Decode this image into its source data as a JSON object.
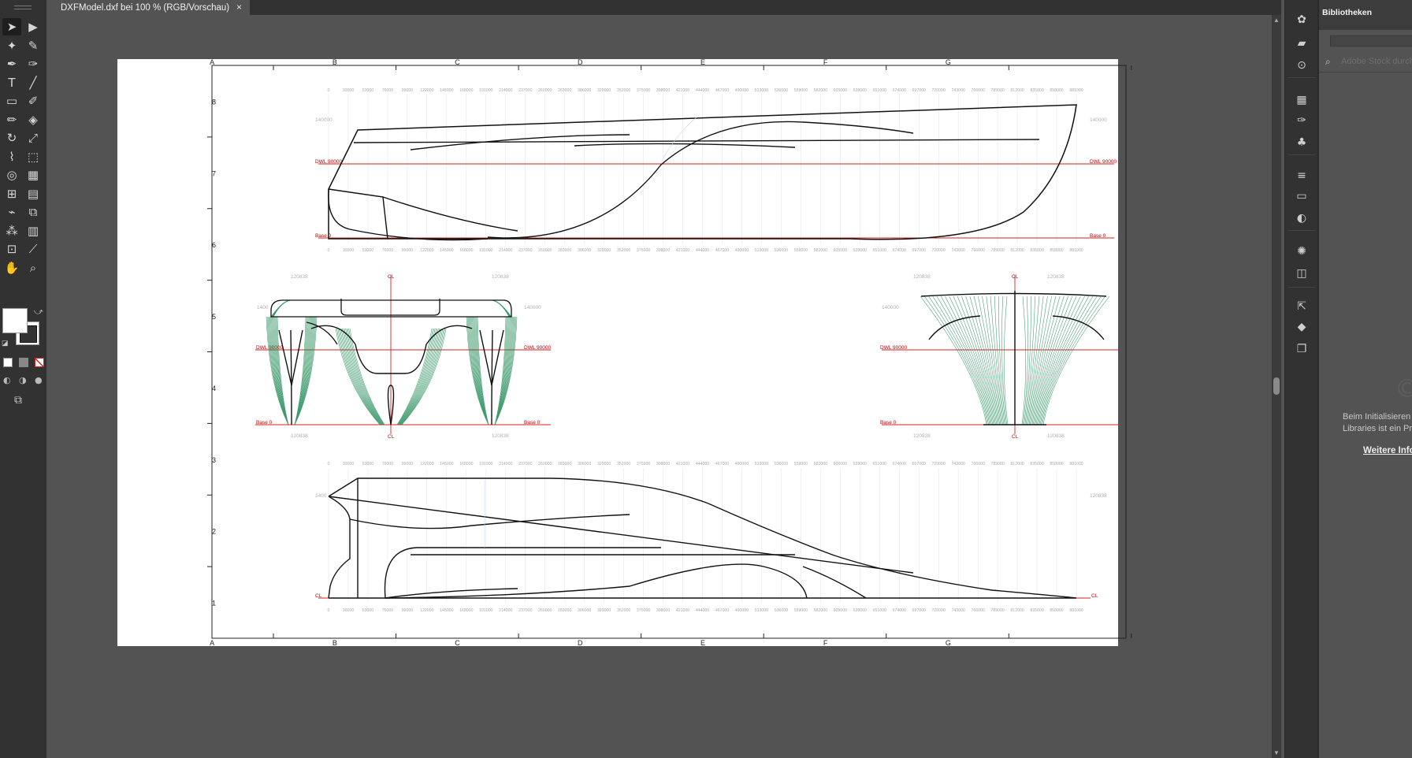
{
  "document_tab": {
    "title": "DXFModel.dxf bei 100 % (RGB/Vorschau)",
    "close": "×"
  },
  "tools": [
    {
      "name": "selection-tool",
      "glyph": "➤"
    },
    {
      "name": "direct-selection-tool",
      "glyph": "▶"
    },
    {
      "name": "magic-wand-tool",
      "glyph": "✦"
    },
    {
      "name": "lasso-tool",
      "glyph": "✎"
    },
    {
      "name": "pen-tool",
      "glyph": "✒"
    },
    {
      "name": "curvature-tool",
      "glyph": "✑"
    },
    {
      "name": "type-tool",
      "glyph": "T"
    },
    {
      "name": "line-segment-tool",
      "glyph": "╱"
    },
    {
      "name": "rectangle-tool",
      "glyph": "▭"
    },
    {
      "name": "paintbrush-tool",
      "glyph": "✐"
    },
    {
      "name": "shaper-tool",
      "glyph": "✏"
    },
    {
      "name": "eraser-tool",
      "glyph": "◈"
    },
    {
      "name": "rotate-tool",
      "glyph": "↻"
    },
    {
      "name": "scale-tool",
      "glyph": "⤢"
    },
    {
      "name": "warp-tool",
      "glyph": "⌇"
    },
    {
      "name": "free-transform-tool",
      "glyph": "⬚"
    },
    {
      "name": "shape-builder-tool",
      "glyph": "◎"
    },
    {
      "name": "perspective-grid-tool",
      "glyph": "▦"
    },
    {
      "name": "mesh-tool",
      "glyph": "⊞"
    },
    {
      "name": "gradient-tool",
      "glyph": "▤"
    },
    {
      "name": "eyedropper-tool",
      "glyph": "⌁"
    },
    {
      "name": "blend-tool",
      "glyph": "⧉"
    },
    {
      "name": "symbol-sprayer-tool",
      "glyph": "⁂"
    },
    {
      "name": "column-graph-tool",
      "glyph": "▥"
    },
    {
      "name": "artboard-tool",
      "glyph": "⊡"
    },
    {
      "name": "slice-tool",
      "glyph": "⟋"
    },
    {
      "name": "hand-tool",
      "glyph": "✋"
    },
    {
      "name": "zoom-tool",
      "glyph": "⌕"
    }
  ],
  "dock_icons": [
    "libraries-icon",
    "properties-icon",
    "cc-libraries-icon",
    "swatches-icon",
    "brushes-icon",
    "symbols-icon",
    "stroke-icon",
    "gradient-icon",
    "transparency-icon",
    "appearance-icon",
    "graphic-styles-icon",
    "export-icon",
    "layers-icon",
    "artboards-icon"
  ],
  "panel": {
    "tab": "Bibliotheken",
    "search_placeholder": "Adobe Stock durchsuchen",
    "message_line1": "Beim Initialisieren von",
    "message_line2": "Libraries ist ein Problem",
    "link": "Weitere Informationen"
  },
  "drawing": {
    "col_letters": [
      "A",
      "B",
      "C",
      "D",
      "E",
      "F",
      "G"
    ],
    "row_numbers": [
      "8",
      "7",
      "6",
      "5",
      "4",
      "3",
      "2",
      "1"
    ],
    "stations": [
      "0",
      "30000",
      "53000",
      "76000",
      "99000",
      "122000",
      "145000",
      "168000",
      "191000",
      "214000",
      "237000",
      "260000",
      "283000",
      "306000",
      "329000",
      "352000",
      "375000",
      "398000",
      "421000",
      "444000",
      "467000",
      "490000",
      "513000",
      "536000",
      "559000",
      "582000",
      "605000",
      "628000",
      "651000",
      "674000",
      "697000",
      "720000",
      "743000",
      "766000",
      "789000",
      "812000",
      "835000",
      "858000",
      "881000"
    ],
    "dwl_label": "DWL 90000",
    "base_label": "Base 0",
    "cl_label": "CL",
    "height_label": "140000",
    "beam_label": "120838",
    "side_left_label": "1400"
  },
  "colors": {
    "waterline": "#d42020",
    "sections": "#1f8a55",
    "grid": "#cfcfcf",
    "hull": "#111111"
  }
}
